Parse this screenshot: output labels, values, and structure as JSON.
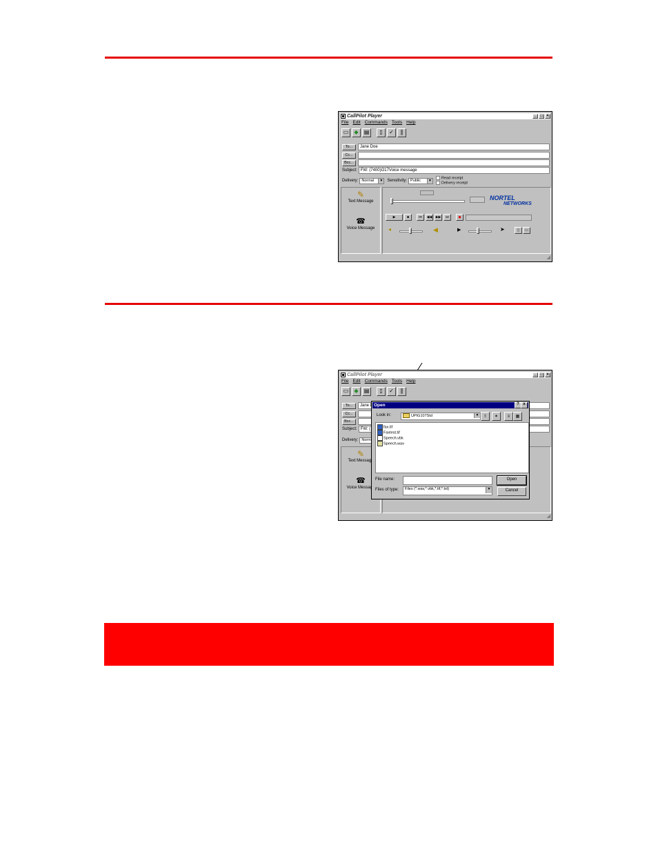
{
  "window1": {
    "title": "CallPilot Player",
    "menu": [
      "File",
      "Edit",
      "Commands",
      "Tools",
      "Help"
    ],
    "toolbar_icons": [
      "new-message-icon",
      "send-icon",
      "print-icon",
      "book-icon",
      "spellcheck-icon",
      "attach-icon"
    ],
    "address": {
      "to_label": "To...",
      "cc_label": "Cc...",
      "bcc_label": "Bcc...",
      "to_value": "Jane Doe",
      "cc_value": "",
      "bcc_value": "",
      "subject_label": "Subject:",
      "subject_value": "FW: (7400)O17Voice message"
    },
    "delivery": {
      "label": "Delivery:",
      "value": "Normal",
      "sensitivity_label": "Sensitivity:",
      "sensitivity_value": "Public",
      "read_receipt": "Read receipt",
      "delivery_receipt": "Delivery receipt"
    },
    "left_pane": {
      "text_message": "Text Message",
      "voice_message": "Voice Message"
    },
    "brand": {
      "line1": "NORTEL",
      "line2": "NETWORKS"
    }
  },
  "window2": {
    "title": "CallPilot Player",
    "menu": [
      "File",
      "Edit",
      "Commands",
      "Tools",
      "Help"
    ],
    "to_label": "To...",
    "cc_label": "Cc...",
    "bcc_label": "Bcc...",
    "to_value_partial": "Jane D",
    "subject_label": "Subject:",
    "subject_value_partial": "FW: (",
    "delivery_label": "Delivery:",
    "delivery_value_partial": "Norm",
    "text_message": "Text Message",
    "voice_message": "Voice Message",
    "open_dialog": {
      "title": "Open",
      "help_btn": "?",
      "close_btn": "x",
      "look_in_label": "Look in:",
      "look_in_value": "UPIG107Std",
      "files": [
        "fax.tif",
        "Faxtest.tif",
        "Speech.vbk",
        "Speech.wav"
      ],
      "file_name_label": "File name:",
      "file_name_value": "",
      "files_of_type_label": "Files of type:",
      "files_of_type_value": "Files (*.wav,*.vbk,*.tif,*.txt)",
      "open_button": "Open",
      "cancel_button": "Cancel"
    }
  },
  "colors": {
    "rule": "#e60000",
    "banner": "#ff0000",
    "window_bg": "#c0c0c0",
    "dialog_title": "#000080"
  }
}
